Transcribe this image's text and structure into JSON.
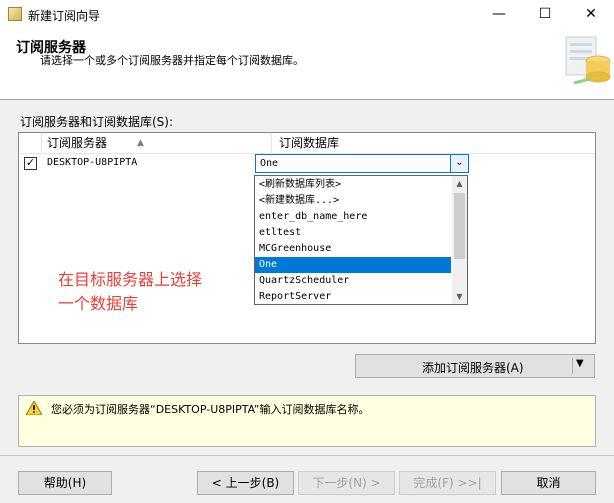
{
  "window": {
    "title": "新建订阅向导",
    "min_glyph": "—",
    "max_glyph": "☐",
    "close_glyph": "✕"
  },
  "header": {
    "title": "订阅服务器",
    "subtitle": "请选择一个或多个订阅服务器并指定每个订阅数据库。"
  },
  "list_label": "订阅服务器和订阅数据库(S):",
  "grid": {
    "columns": [
      "订阅服务器",
      "订阅数据库"
    ],
    "sort_glyph": "▲",
    "rows": [
      {
        "checked": true,
        "check_glyph": "✓",
        "server": "DESKTOP-U8PIPTA",
        "database": "One"
      }
    ]
  },
  "dropdown": {
    "arrow_glyph": "⌄",
    "scroll_up": "▲",
    "scroll_down": "▼",
    "items": [
      "<刷新数据库列表>",
      "<新建数据库...>",
      "enter_db_name_here",
      "etltest",
      "MCGreenhouse",
      "One",
      "QuartzScheduler",
      "ReportServer"
    ],
    "selected": "One"
  },
  "annotation": {
    "line1": "在目标服务器上选择",
    "line2": "一个数据库",
    "color": "#e8403b"
  },
  "add_button": {
    "label": "添加订阅服务器(A)",
    "arrow": "▼"
  },
  "message": {
    "text": "您必须为订阅服务器“DESKTOP-U8PIPTA”输入订阅数据库名称。"
  },
  "buttons": {
    "help": "帮助(H)",
    "back": "< 上一步(B)",
    "next": "下一步(N) >",
    "finish": "完成(F) >>|",
    "cancel": "取消"
  },
  "colors": {
    "accent": "#0078d7",
    "selected_bg": "#0078d7",
    "message_bg": "#ffffe1"
  }
}
